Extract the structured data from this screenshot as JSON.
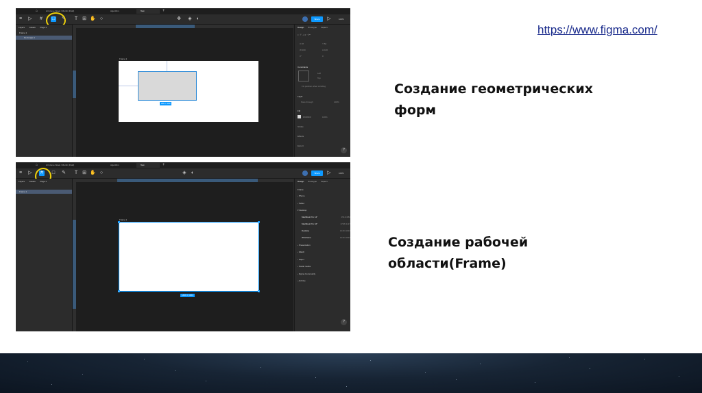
{
  "link": "https://www.figma.com/",
  "captions": {
    "geometry": "Создание геометрических форм",
    "frame": "Создание рабочей области(Frame)"
  },
  "shot1": {
    "tabs": [
      "Art Home Week / Month (Draft)",
      "Algorithm",
      "Test"
    ],
    "layers_tabs": [
      "Layers",
      "Assets"
    ],
    "page_label": "Page 1",
    "layers": [
      "Frame 1",
      "Rectangle 1"
    ],
    "right_tabs": [
      "Design",
      "Prototype",
      "Inspect"
    ],
    "share_label": "Share",
    "zoom_label": "100%",
    "frame_label": "Frame 1",
    "rect_size_badge": "200 × 100",
    "props": {
      "x": "X 87",
      "y": "Y 50",
      "w": "W 200",
      "h": "H 100",
      "rot": "0°",
      "radius": "0"
    },
    "sections": {
      "constraints": "Constraints",
      "constraint_left": "Left",
      "constraint_top": "Top",
      "fix_scroll": "Fix position when scrolling",
      "layer": "Layer",
      "pass_through": "Pass through",
      "opacity": "100%",
      "fill": "Fill",
      "fill_hex": "D9D9D9",
      "fill_opacity": "100%",
      "stroke": "Stroke",
      "effects": "Effects",
      "export": "Export"
    },
    "help": "?"
  },
  "shot2": {
    "tabs": [
      "Art Home Week / Month (Draft)",
      "Algorithm",
      "Test"
    ],
    "layers_tabs": [
      "Layers",
      "Assets"
    ],
    "page_label": "Page 1",
    "layers": [
      "Frame 1"
    ],
    "right_tabs": [
      "Design",
      "Prototype",
      "Inspect"
    ],
    "share_label": "Share",
    "zoom_label": "100%",
    "frame_label": "Frame 1",
    "frame_size_badge": "1440 × 1024",
    "frame_section": "Frame",
    "presets": [
      {
        "name": "Phone",
        "group": true
      },
      {
        "name": "Tablet",
        "group": true
      },
      {
        "name": "Desktop",
        "group": true,
        "open": true
      },
      {
        "name": "MacBook Pro 14\"",
        "size": "1512×982"
      },
      {
        "name": "MacBook Pro 16\"",
        "size": "1728×1117"
      },
      {
        "name": "Desktop",
        "size": "1440×1024"
      },
      {
        "name": "Wireframe",
        "size": "1440×1024"
      },
      {
        "name": "Presentation",
        "group": true
      },
      {
        "name": "Watch",
        "group": true
      },
      {
        "name": "Paper",
        "group": true
      },
      {
        "name": "Social media",
        "group": true
      },
      {
        "name": "Figma Community",
        "group": true
      },
      {
        "name": "Archive",
        "group": true
      }
    ],
    "help": "?"
  }
}
